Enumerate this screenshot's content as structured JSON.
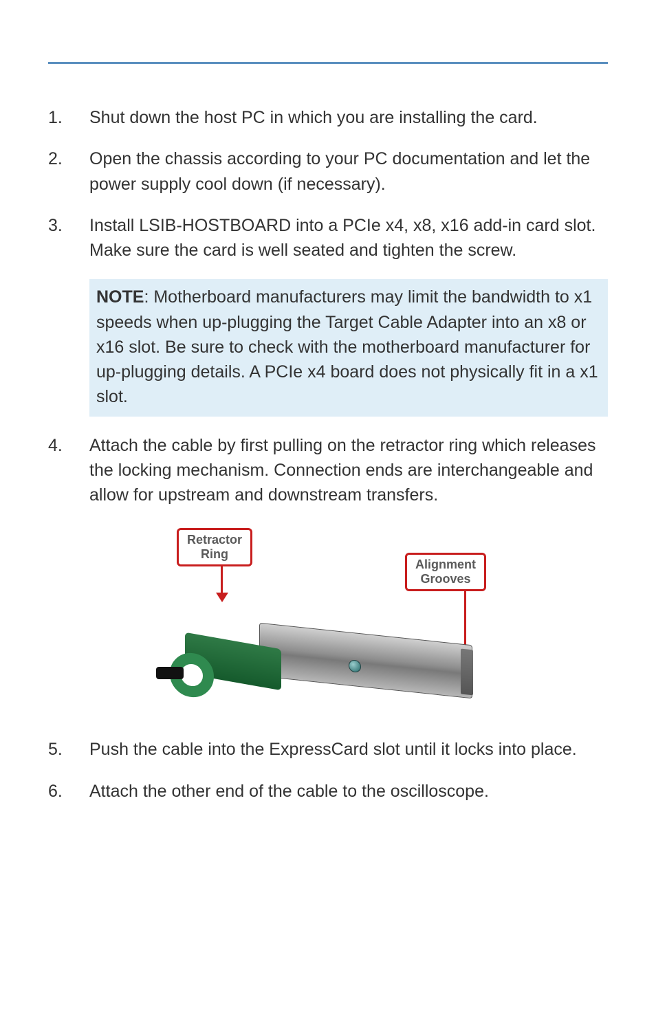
{
  "steps": [
    {
      "num": "1.",
      "text": "Shut down the host PC in which you are installing the card."
    },
    {
      "num": "2.",
      "text": "Open the chassis according to your PC documentation and let the power supply cool down (if necessary)."
    },
    {
      "num": "3.",
      "text": "Install LSIB-HOSTBOARD into a PCIe x4, x8, x16 add-in card slot. Make sure the card is well seated and tighten the screw."
    },
    {
      "num": "4.",
      "text": "Attach the cable by first pulling on the retractor ring which releases the locking mechanism. Connection ends are interchangeable and allow for upstream and downstream transfers."
    },
    {
      "num": "5.",
      "text": "Push the cable into the ExpressCard slot until it locks into place."
    },
    {
      "num": "6.",
      "text": "Attach the other end of the cable to the oscilloscope."
    }
  ],
  "note": {
    "label": "NOTE",
    "text": ": Motherboard manufacturers may limit the bandwidth to x1 speeds when up-plugging the Target Cable Adapter into an x8 or x16 slot. Be sure to check with the motherboard manufacturer for up-plugging details. A PCIe x4 board does not physically fit in a x1 slot."
  },
  "figure": {
    "callout_left_line1": "Retractor",
    "callout_left_line2": "Ring",
    "callout_right_line1": "Alignment",
    "callout_right_line2": "Grooves"
  }
}
